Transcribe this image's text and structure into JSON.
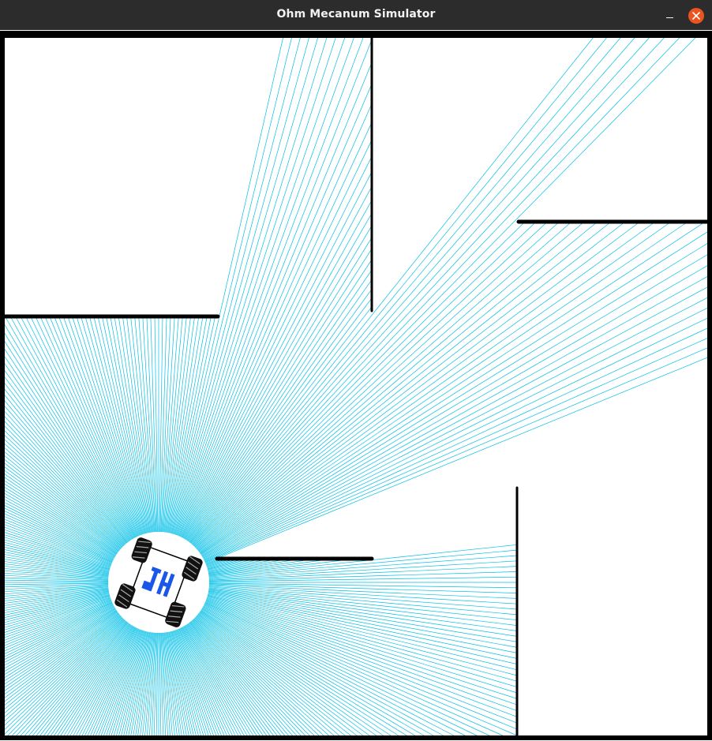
{
  "window": {
    "title": "Ohm Mecanum Simulator",
    "close_icon": "close-icon",
    "minimize_icon": "minimize-icon"
  },
  "colors": {
    "titlebar": "#2c2c2c",
    "close_button": "#e95420",
    "laser_rays": "#00bfe6",
    "walls": "#000000",
    "robot_logo": "#1a56e8",
    "background": "#ffffff"
  },
  "scene": {
    "robot_icon": "mecanum-robot-icon",
    "logo_icon": "th-logo-icon"
  }
}
